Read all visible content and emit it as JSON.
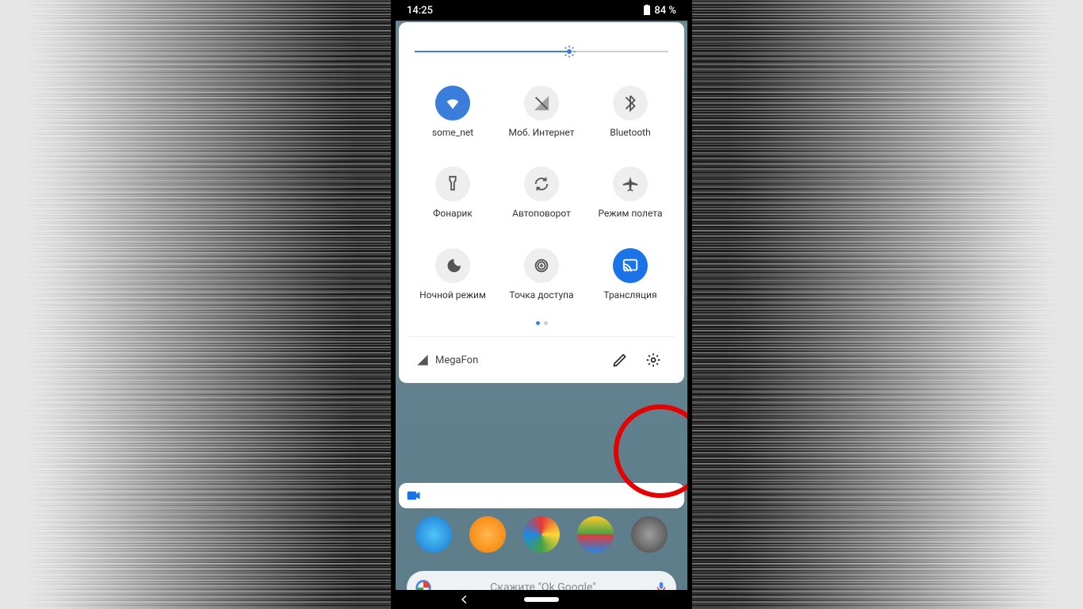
{
  "status": {
    "time": "14:25",
    "battery": "84 %"
  },
  "brightness": {
    "percent": 61
  },
  "tiles": [
    {
      "id": "wifi",
      "label": "some_net",
      "icon": "wifi",
      "state": "on"
    },
    {
      "id": "data",
      "label": "Моб. Интернет",
      "icon": "signal-off",
      "state": "off"
    },
    {
      "id": "bluetooth",
      "label": "Bluetooth",
      "icon": "bluetooth",
      "state": "off"
    },
    {
      "id": "flashlight",
      "label": "Фонарик",
      "icon": "flashlight",
      "state": "off"
    },
    {
      "id": "rotate",
      "label": "Автоповорот",
      "icon": "rotate",
      "state": "off"
    },
    {
      "id": "airplane",
      "label": "Режим полета",
      "icon": "airplane",
      "state": "off"
    },
    {
      "id": "night",
      "label": "Ночной режим",
      "icon": "moon",
      "state": "off"
    },
    {
      "id": "hotspot",
      "label": "Точка доступа",
      "icon": "hotspot",
      "state": "off"
    },
    {
      "id": "cast",
      "label": "Трансляция",
      "icon": "cast",
      "state": "accent"
    }
  ],
  "pages": {
    "count": 2,
    "active": 0
  },
  "footer": {
    "carrier": "MegaFon"
  },
  "search": {
    "hint": "Скажите \"Ok Google\""
  },
  "highlight": {
    "target": "edit-settings"
  }
}
